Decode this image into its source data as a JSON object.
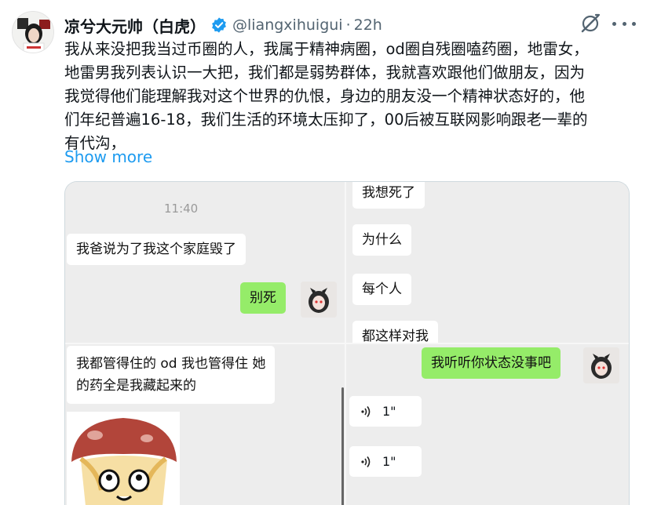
{
  "tweet": {
    "author_name": "凉兮大元帅（白虎）",
    "handle": "@liangxihuigui",
    "separator": "·",
    "time": "22h",
    "text_lines": [
      "我从来没把我当过币圈的人，我属于精神病圈，od圈自残圈嗑药圈，地雷女，",
      "地雷男我列表认识一大把，我们都是弱势群体，我就喜欢跟他们做朋友，因为",
      "我觉得他们能理解我对这个世界的仇恨，身边的朋友没一个精神状态好的，他",
      "们年纪普遍16-18，我们生活的环境太压抑了，00后被互联网影响跟老一辈的",
      "有代沟，"
    ],
    "show_more": "Show more"
  },
  "icons": {
    "verified": "verified-badge-icon",
    "grok": "grok-icon",
    "more": "more-options-icon",
    "voice": "voice-message-icon"
  },
  "colors": {
    "link_blue": "#1d9bf0",
    "muted_text": "#536471",
    "chat_green": "#95ec69",
    "chat_bg": "#ededed"
  },
  "chat": {
    "tl": {
      "timestamp": "11:40",
      "msg_received": "我爸说为了我这个家庭毁了",
      "msg_sent": "别死"
    },
    "tr": {
      "msg1": "我想死了",
      "msg2": "为什么",
      "msg3": "每个人",
      "msg4": "都这样对我"
    },
    "bl": {
      "msg_line1": "我都管得住的 od 我也管得住 她",
      "msg_line2": "的药全是我藏起来的"
    },
    "br": {
      "msg_sent": "我听听你状态没事吧",
      "voice1": "1\"",
      "voice2": "1\""
    }
  }
}
